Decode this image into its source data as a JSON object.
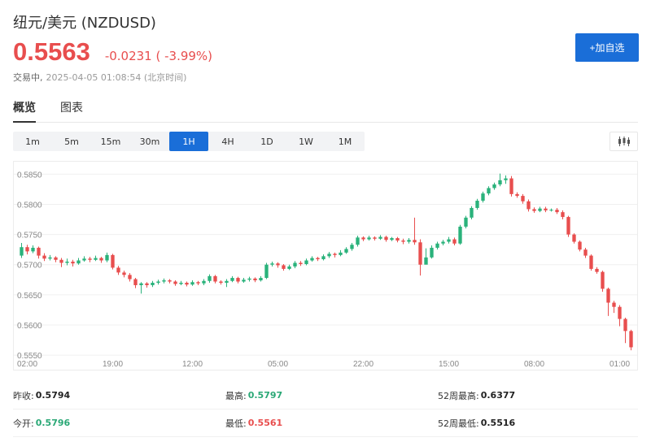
{
  "header": {
    "title": "纽元/美元  (NZDUSD)",
    "price": "0.5563",
    "change": "-0.0231 ( -3.99%)",
    "status": "交易中,",
    "timestamp": "2025-04-05 01:08:54  (北京时间)",
    "add_button": "+加自选"
  },
  "tabs": [
    {
      "label": "概览",
      "active": true
    },
    {
      "label": "图表",
      "active": false
    }
  ],
  "periods": [
    {
      "label": "1m",
      "active": false
    },
    {
      "label": "5m",
      "active": false
    },
    {
      "label": "15m",
      "active": false
    },
    {
      "label": "30m",
      "active": false
    },
    {
      "label": "1H",
      "active": true
    },
    {
      "label": "4H",
      "active": false
    },
    {
      "label": "1D",
      "active": false
    },
    {
      "label": "1W",
      "active": false
    },
    {
      "label": "1M",
      "active": false
    }
  ],
  "colors": {
    "up": "#2ab27b",
    "down": "#e84e4e",
    "accent": "#1a6ed8"
  },
  "chart_data": {
    "type": "candlestick",
    "y_ticks": [
      "0.5850",
      "0.5800",
      "0.5750",
      "0.5700",
      "0.5650",
      "0.5600",
      "0.5550"
    ],
    "ylim": [
      0.5538,
      0.5868
    ],
    "x_ticks": [
      {
        "index": 1,
        "label": "02:00"
      },
      {
        "index": 16,
        "label": "19:00"
      },
      {
        "index": 30,
        "label": "12:00"
      },
      {
        "index": 45,
        "label": "05:00"
      },
      {
        "index": 60,
        "label": "22:00"
      },
      {
        "index": 75,
        "label": "15:00"
      },
      {
        "index": 90,
        "label": "08:00"
      },
      {
        "index": 105,
        "label": "01:00"
      }
    ],
    "candles": [
      [
        0.5715,
        0.5729,
        0.5736,
        0.5711
      ],
      [
        0.5729,
        0.5722,
        0.5733,
        0.5717
      ],
      [
        0.5722,
        0.5728,
        0.5732,
        0.5719
      ],
      [
        0.5728,
        0.5715,
        0.573,
        0.571
      ],
      [
        0.5715,
        0.571,
        0.5719,
        0.5706
      ],
      [
        0.571,
        0.5712,
        0.5716,
        0.5707
      ],
      [
        0.5712,
        0.5708,
        0.5714,
        0.5704
      ],
      [
        0.5708,
        0.5703,
        0.5711,
        0.5696
      ],
      [
        0.5703,
        0.5705,
        0.571,
        0.5699
      ],
      [
        0.5705,
        0.5702,
        0.5708,
        0.5697
      ],
      [
        0.5702,
        0.5707,
        0.5711,
        0.57
      ],
      [
        0.5707,
        0.571,
        0.5714,
        0.5705
      ],
      [
        0.571,
        0.5708,
        0.5713,
        0.5704
      ],
      [
        0.5708,
        0.5711,
        0.5715,
        0.5706
      ],
      [
        0.5711,
        0.5707,
        0.5713,
        0.5703
      ],
      [
        0.5707,
        0.5716,
        0.572,
        0.5704
      ],
      [
        0.5716,
        0.5695,
        0.5718,
        0.5692
      ],
      [
        0.5695,
        0.5687,
        0.5698,
        0.5683
      ],
      [
        0.5687,
        0.5683,
        0.569,
        0.5679
      ],
      [
        0.5683,
        0.5676,
        0.5686,
        0.5672
      ],
      [
        0.5676,
        0.5666,
        0.5678,
        0.5661
      ],
      [
        0.5666,
        0.5669,
        0.5671,
        0.5652
      ],
      [
        0.5669,
        0.5666,
        0.5671,
        0.5662
      ],
      [
        0.5666,
        0.567,
        0.5673,
        0.5663
      ],
      [
        0.567,
        0.5672,
        0.5675,
        0.5667
      ],
      [
        0.5672,
        0.5674,
        0.5677,
        0.5669
      ],
      [
        0.5674,
        0.5672,
        0.5676,
        0.5669
      ],
      [
        0.5672,
        0.5668,
        0.5674,
        0.5665
      ],
      [
        0.5668,
        0.567,
        0.5673,
        0.5666
      ],
      [
        0.567,
        0.5667,
        0.5672,
        0.5664
      ],
      [
        0.5667,
        0.5671,
        0.5674,
        0.5665
      ],
      [
        0.5671,
        0.5669,
        0.5673,
        0.5666
      ],
      [
        0.5669,
        0.5673,
        0.5676,
        0.5666
      ],
      [
        0.5673,
        0.5681,
        0.5684,
        0.567
      ],
      [
        0.5681,
        0.5672,
        0.5683,
        0.5669
      ],
      [
        0.5672,
        0.567,
        0.5674,
        0.5667
      ],
      [
        0.567,
        0.5673,
        0.5676,
        0.5663
      ],
      [
        0.5673,
        0.5678,
        0.5681,
        0.5671
      ],
      [
        0.5678,
        0.5672,
        0.568,
        0.5669
      ],
      [
        0.5672,
        0.5675,
        0.5678,
        0.567
      ],
      [
        0.5675,
        0.5677,
        0.568,
        0.5672
      ],
      [
        0.5677,
        0.5674,
        0.5679,
        0.5671
      ],
      [
        0.5674,
        0.5678,
        0.5681,
        0.5672
      ],
      [
        0.5678,
        0.57,
        0.5703,
        0.5676
      ],
      [
        0.57,
        0.5702,
        0.5705,
        0.5697
      ],
      [
        0.5702,
        0.5699,
        0.5704,
        0.5695
      ],
      [
        0.5699,
        0.5693,
        0.5701,
        0.569
      ],
      [
        0.5693,
        0.5697,
        0.57,
        0.5691
      ],
      [
        0.5697,
        0.5703,
        0.5706,
        0.5694
      ],
      [
        0.5703,
        0.5701,
        0.5706,
        0.5698
      ],
      [
        0.5701,
        0.5707,
        0.571,
        0.5699
      ],
      [
        0.5707,
        0.5711,
        0.5714,
        0.5705
      ],
      [
        0.5711,
        0.5709,
        0.5713,
        0.5706
      ],
      [
        0.5709,
        0.5714,
        0.5717,
        0.5707
      ],
      [
        0.5714,
        0.5718,
        0.5721,
        0.5711
      ],
      [
        0.5718,
        0.5716,
        0.572,
        0.5712
      ],
      [
        0.5716,
        0.572,
        0.5724,
        0.5714
      ],
      [
        0.572,
        0.5726,
        0.5729,
        0.5718
      ],
      [
        0.5726,
        0.5733,
        0.5736,
        0.5723
      ],
      [
        0.5733,
        0.5745,
        0.5748,
        0.573
      ],
      [
        0.5745,
        0.5742,
        0.5747,
        0.5739
      ],
      [
        0.5742,
        0.5745,
        0.5748,
        0.574
      ],
      [
        0.5745,
        0.5743,
        0.5747,
        0.574
      ],
      [
        0.5743,
        0.5746,
        0.5749,
        0.5741
      ],
      [
        0.5746,
        0.5741,
        0.5748,
        0.5738
      ],
      [
        0.5741,
        0.5744,
        0.5746,
        0.5739
      ],
      [
        0.5744,
        0.574,
        0.5746,
        0.5737
      ],
      [
        0.574,
        0.5738,
        0.5743,
        0.5734
      ],
      [
        0.5738,
        0.5741,
        0.5744,
        0.5735
      ],
      [
        0.5741,
        0.5737,
        0.5778,
        0.5733
      ],
      [
        0.5737,
        0.57,
        0.5742,
        0.5682
      ],
      [
        0.57,
        0.5712,
        0.5727,
        0.5703
      ],
      [
        0.5712,
        0.5728,
        0.5732,
        0.571
      ],
      [
        0.5728,
        0.5735,
        0.5738,
        0.5725
      ],
      [
        0.5735,
        0.5738,
        0.5741,
        0.5732
      ],
      [
        0.5738,
        0.5742,
        0.5746,
        0.5735
      ],
      [
        0.5742,
        0.5735,
        0.5745,
        0.5732
      ],
      [
        0.5735,
        0.5763,
        0.5766,
        0.5733
      ],
      [
        0.5763,
        0.5778,
        0.5781,
        0.576
      ],
      [
        0.5778,
        0.5794,
        0.5797,
        0.5775
      ],
      [
        0.5794,
        0.5806,
        0.5809,
        0.5791
      ],
      [
        0.5806,
        0.5818,
        0.5821,
        0.5803
      ],
      [
        0.5818,
        0.5827,
        0.583,
        0.5815
      ],
      [
        0.5827,
        0.5833,
        0.5836,
        0.5824
      ],
      [
        0.5833,
        0.584,
        0.5851,
        0.583
      ],
      [
        0.584,
        0.5843,
        0.5848,
        0.5834
      ],
      [
        0.5843,
        0.5817,
        0.5847,
        0.5813
      ],
      [
        0.5817,
        0.5814,
        0.582,
        0.5811
      ],
      [
        0.5814,
        0.5805,
        0.5817,
        0.5801
      ],
      [
        0.5805,
        0.5792,
        0.5808,
        0.5788
      ],
      [
        0.5792,
        0.5789,
        0.5795,
        0.5786
      ],
      [
        0.5789,
        0.5793,
        0.5796,
        0.5787
      ],
      [
        0.5793,
        0.579,
        0.5796,
        0.5787
      ],
      [
        0.579,
        0.5791,
        0.5793,
        0.5788
      ],
      [
        0.5791,
        0.5787,
        0.5794,
        0.5784
      ],
      [
        0.5787,
        0.5779,
        0.579,
        0.5775
      ],
      [
        0.5779,
        0.575,
        0.5781,
        0.5746
      ],
      [
        0.575,
        0.5738,
        0.5752,
        0.5735
      ],
      [
        0.5738,
        0.5725,
        0.574,
        0.5722
      ],
      [
        0.5725,
        0.5715,
        0.5728,
        0.5711
      ],
      [
        0.5715,
        0.5693,
        0.5717,
        0.569
      ],
      [
        0.5693,
        0.5688,
        0.5696,
        0.5685
      ],
      [
        0.5688,
        0.566,
        0.569,
        0.5655
      ],
      [
        0.566,
        0.5637,
        0.5662,
        0.5615
      ],
      [
        0.5637,
        0.563,
        0.564,
        0.562
      ],
      [
        0.563,
        0.561,
        0.5633,
        0.5598
      ],
      [
        0.561,
        0.559,
        0.5612,
        0.557
      ],
      [
        0.559,
        0.5563,
        0.5592,
        0.5558
      ]
    ]
  },
  "stats": [
    [
      {
        "label": "昨收:",
        "value": "0.5794",
        "tone": "black"
      },
      {
        "label": "最高:",
        "value": "0.5797",
        "tone": "green"
      },
      {
        "label": "52周最高:",
        "value": "0.6377",
        "tone": "black"
      }
    ],
    [
      {
        "label": "今开:",
        "value": "0.5796",
        "tone": "green"
      },
      {
        "label": "最低:",
        "value": "0.5561",
        "tone": "red"
      },
      {
        "label": "52周最低:",
        "value": "0.5516",
        "tone": "black"
      }
    ]
  ]
}
